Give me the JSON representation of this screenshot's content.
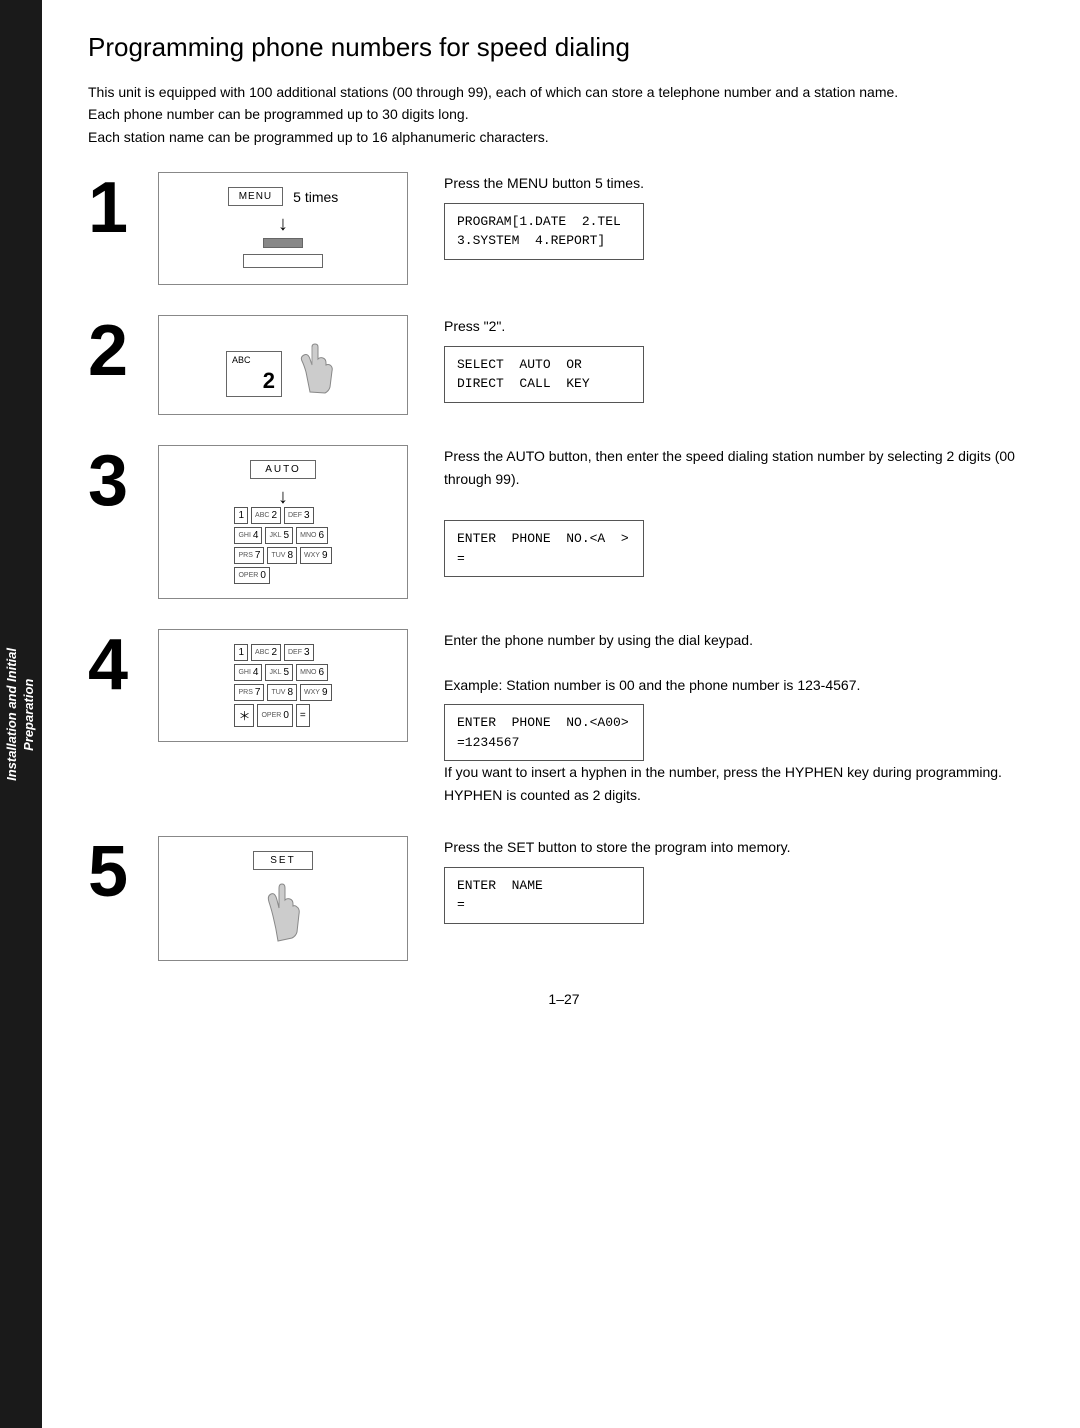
{
  "sidebar": {
    "line1": "Installation and Initial",
    "line2": "Preparation"
  },
  "page": {
    "title": "Programming phone numbers for speed dialing",
    "intro": [
      "This unit is equipped with 100 additional stations (00 through 99), each of which can store a telephone number and a station name.",
      "Each phone number can be programmed up to 30 digits long.",
      "Each station name can be programmed up to 16 alphanumeric characters."
    ]
  },
  "steps": [
    {
      "number": "1",
      "desc_line1": "Press the MENU button 5 times.",
      "display": "PROGRAM[1.DATE  2.TEL\n3.SYSTEM  4.REPORT]",
      "diagram_label": "MENU",
      "times": "5 times"
    },
    {
      "number": "2",
      "desc_line1": "Press \"2\".",
      "display": "SELECT  AUTO  OR\nDIRECT  CALL  KEY",
      "key_label_small": "ABC",
      "key_label_large": "2"
    },
    {
      "number": "3",
      "desc_line1": "Press the AUTO button, then enter the speed dialing station number by selecting 2 digits (00 through 99).",
      "display": "ENTER  PHONE  NO.<A  >\n=",
      "auto_label": "AUTO"
    },
    {
      "number": "4",
      "desc_line1": "Enter the phone number by using the dial keypad.",
      "desc_line2": "Example:  Station number is 00 and the phone number is 123-4567.",
      "display": "ENTER  PHONE  NO.<A00>\n=1234567",
      "desc_line3": "If you want to insert a hyphen in the number, press the HYPHEN key during programming. HYPHEN is counted as 2 digits."
    },
    {
      "number": "5",
      "desc_line1": "Press the SET button to store the program into memory.",
      "display": "ENTER  NAME\n=",
      "set_label": "SET"
    }
  ],
  "keypad": {
    "keys": [
      {
        "sub": "",
        "num": "1"
      },
      {
        "sub": "ABC",
        "num": "2"
      },
      {
        "sub": "DEF",
        "num": "3"
      },
      {
        "sub": "GHI",
        "num": "4"
      },
      {
        "sub": "JKL",
        "num": "5"
      },
      {
        "sub": "MNO",
        "num": "6"
      },
      {
        "sub": "PRS",
        "num": "7"
      },
      {
        "sub": "TUV",
        "num": "8"
      },
      {
        "sub": "WXY",
        "num": "9"
      },
      {
        "sub": "OPER",
        "num": "0"
      }
    ]
  },
  "page_number": "1–27"
}
